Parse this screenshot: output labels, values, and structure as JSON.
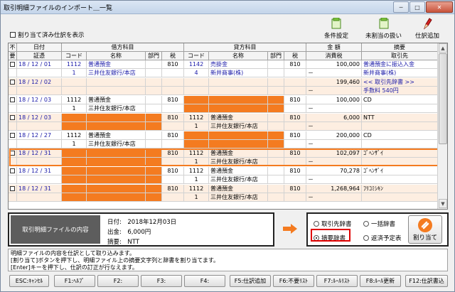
{
  "window": {
    "title": "取引明細ファイルのインポート＿一覧"
  },
  "toolbar": {
    "conditions": "条件設定",
    "unassigned": "未割当の扱い",
    "add_entry": "仕訳追加"
  },
  "filter": {
    "show_assigned_label": "割り当て済み仕訳を表示"
  },
  "grid": {
    "group_headers": {
      "exclude": "不",
      "date": "日付",
      "debit": "借方科目",
      "credit": "貸方科目",
      "amount": "金 額",
      "summary": "摘要"
    },
    "sub_headers": {
      "exclude": "要",
      "voucher": "証憑",
      "code": "コード",
      "name": "名称",
      "dept": "部門",
      "tax": "税",
      "ccode": "コード",
      "cname": "名称",
      "cdept": "部門",
      "ctax": "税",
      "consumption_tax": "消費税",
      "partner": "取引先"
    },
    "rows": [
      {
        "top": {
          "date": "18 / 12 / 01",
          "code": "1112",
          "name": "普通預金",
          "dept": "",
          "tax": "810",
          "ccode": "1142",
          "cname": "売掛金",
          "cdept": "",
          "ctax": "810",
          "amount": "100,000",
          "summary": "普通預金に振込入金"
        },
        "bot": {
          "code": "1",
          "name": "三井住友銀行/本店",
          "ccode": "4",
          "cname": "新井商事(株)",
          "tax_amount": "－",
          "partner": "新井商事(株)"
        }
      },
      {
        "top": {
          "date": "18 / 12 / 02",
          "code": "",
          "name": "",
          "dept": "",
          "tax": "",
          "ccode": "",
          "cname": "",
          "cdept": "",
          "ctax": "",
          "amount": "199,460",
          "summary": "<< 取引先辞書 >>"
        },
        "bot": {
          "code": "",
          "name": "",
          "ccode": "",
          "cname": "",
          "tax_amount": "－",
          "partner": "手数料 540円"
        }
      },
      {
        "top": {
          "date": "18 / 12 / 03",
          "code": "1112",
          "name": "普通預金",
          "dept": "",
          "tax": "810",
          "ccode": "",
          "cname": "",
          "cdept": "",
          "ctax": "810",
          "amount": "100,000",
          "summary": "CD"
        },
        "bot": {
          "code": "1",
          "name": "三井住友銀行/本店",
          "ccode": "",
          "cname": "",
          "tax_amount": "－",
          "partner": ""
        }
      },
      {
        "top": {
          "date": "18 / 12 / 03",
          "code": "",
          "name": "",
          "dept": "",
          "tax": "810",
          "ccode": "1112",
          "cname": "普通預金",
          "cdept": "",
          "ctax": "810",
          "amount": "6,000",
          "summary": "NTT"
        },
        "bot": {
          "code": "",
          "name": "",
          "ccode": "1",
          "cname": "三井住友銀行/本店",
          "tax_amount": "－",
          "partner": ""
        }
      },
      {
        "top": {
          "date": "18 / 12 / 27",
          "code": "1112",
          "name": "普通預金",
          "dept": "",
          "tax": "810",
          "ccode": "",
          "cname": "",
          "cdept": "",
          "ctax": "810",
          "amount": "200,000",
          "summary": "CD"
        },
        "bot": {
          "code": "1",
          "name": "三井住友銀行/本店",
          "ccode": "",
          "cname": "",
          "tax_amount": "－",
          "partner": ""
        }
      },
      {
        "top": {
          "date": "18 / 12 / 31",
          "code": "",
          "name": "",
          "dept": "",
          "tax": "810",
          "ccode": "1112",
          "cname": "普通預金",
          "cdept": "",
          "ctax": "810",
          "amount": "102,097",
          "summary": "ｺﾞﾍﾝｻﾞｲ"
        },
        "bot": {
          "code": "",
          "name": "",
          "ccode": "1",
          "cname": "三井住友銀行/本店",
          "tax_amount": "－",
          "partner": ""
        }
      },
      {
        "top": {
          "date": "18 / 12 / 31",
          "code": "",
          "name": "",
          "dept": "",
          "tax": "810",
          "ccode": "1112",
          "cname": "普通預金",
          "cdept": "",
          "ctax": "810",
          "amount": "70,278",
          "summary": "ｺﾞﾍﾝｻﾞｲ"
        },
        "bot": {
          "code": "",
          "name": "",
          "ccode": "1",
          "cname": "三井住友銀行/本店",
          "tax_amount": "－",
          "partner": ""
        }
      },
      {
        "top": {
          "date": "18 / 12 / 31",
          "code": "",
          "name": "",
          "dept": "",
          "tax": "810",
          "ccode": "1112",
          "cname": "普通預金",
          "cdept": "",
          "ctax": "810",
          "amount": "1,268,964",
          "summary": "ﾌﾘｺﾐｼｷﾝ"
        },
        "bot": {
          "code": "",
          "name": "",
          "ccode": "1",
          "cname": "三井住友銀行/本店",
          "tax_amount": "－",
          "partner": ""
        }
      }
    ]
  },
  "detail": {
    "label": "取引明細ファイルの内容",
    "date_label": "日付:",
    "date_value": "2018年12月03日",
    "out_label": "出金:",
    "out_value": "6,000円",
    "memo_label": "摘要:",
    "memo_value": "NTT"
  },
  "options": {
    "partner_dict": "取引先辞書",
    "bulk_dict": "一括辞書",
    "summary_dict": "摘要辞書",
    "repayment": "返済予定表",
    "assign_button": "割り当て"
  },
  "message": "明細ファイルの内容を仕訳として取り込みます。\n[割り当て]ボタンを押下し、明細ファイル上の摘要文字列と辞書を割り当てます。\n[Enter]キーを押下し、仕訳の訂正が行なえます。",
  "fkeys": {
    "esc": "ESC:ｷｬﾝｾﾙ",
    "f1": "F1:ﾍﾙﾌﾟ",
    "f2": "F2:",
    "f3": "F3:",
    "f4": "F4:",
    "f5": "F5:仕訳追加",
    "f6": "F6:不要ﾘｽﾄ",
    "f7": "F7:ﾙｰﾙﾘｽﾄ",
    "f8": "F8:ﾙｰﾙ更新",
    "f12": "F12:仕訳書込"
  },
  "colors": {
    "orange": "#f47b20",
    "pink_row": "#fdeee1",
    "link_blue": "#1a1aa8",
    "selection_red": "#e00000"
  }
}
